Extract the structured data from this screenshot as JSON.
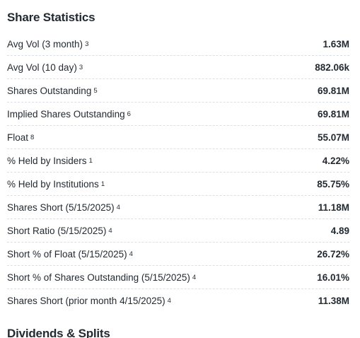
{
  "share_statistics": {
    "title": "Share Statistics",
    "rows": [
      {
        "label": "Avg Vol (3 month)",
        "note": "3",
        "value": "1.63M"
      },
      {
        "label": "Avg Vol (10 day)",
        "note": "3",
        "value": "882.06k"
      },
      {
        "label": "Shares Outstanding",
        "note": "5",
        "value": "69.81M"
      },
      {
        "label": "Implied Shares Outstanding",
        "note": "6",
        "value": "69.81M"
      },
      {
        "label": "Float",
        "note": "8",
        "value": "55.07M"
      },
      {
        "label": "% Held by Insiders",
        "note": "1",
        "value": "4.22%"
      },
      {
        "label": "% Held by Institutions",
        "note": "1",
        "value": "85.75%"
      },
      {
        "label": "Shares Short (5/15/2025)",
        "note": "4",
        "value": "11.18M"
      },
      {
        "label": "Short Ratio (5/15/2025)",
        "note": "4",
        "value": "4.89"
      },
      {
        "label": "Short % of Float (5/15/2025)",
        "note": "4",
        "value": "26.72%"
      },
      {
        "label": "Short % of Shares Outstanding (5/15/2025)",
        "note": "4",
        "value": "16.01%"
      },
      {
        "label": "Shares Short (prior month 4/15/2025)",
        "note": "4",
        "value": "11.38M"
      }
    ]
  },
  "dividends_splits": {
    "title": "Dividends & Splits"
  }
}
